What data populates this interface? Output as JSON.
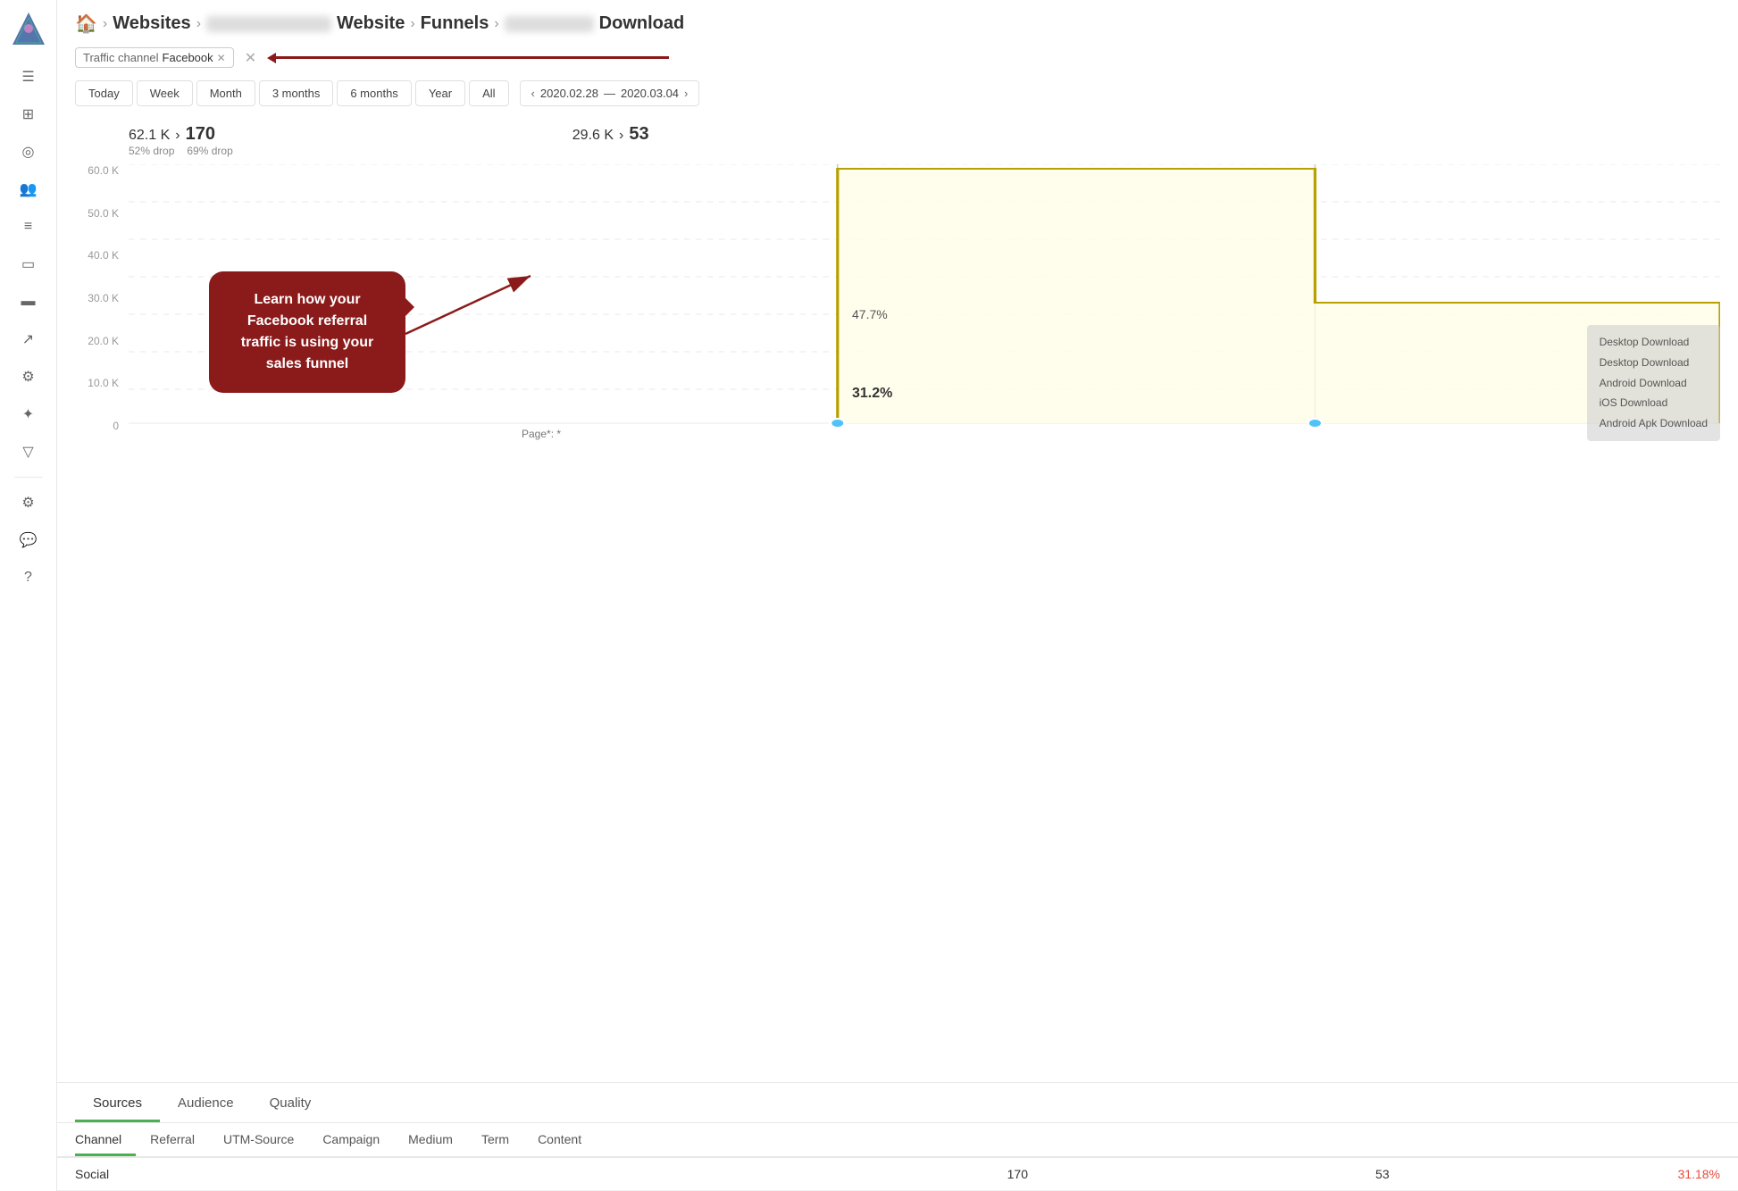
{
  "sidebar": {
    "icons": [
      "≡",
      "⊞",
      "◎",
      "👥",
      "⊟",
      "▭",
      "▬",
      "↗",
      "⚙",
      "✦",
      "▽",
      "⚙",
      "💬",
      "?"
    ]
  },
  "breadcrumb": {
    "home": "🏠",
    "websites": "Websites",
    "website": "Website",
    "funnels": "Funnels",
    "download": "Download"
  },
  "filter": {
    "channel_label": "Traffic channel",
    "channel_value": "Facebook",
    "add_filter": "+"
  },
  "time_range": {
    "buttons": [
      "Today",
      "Week",
      "Month",
      "3 months",
      "6 months",
      "Year",
      "All"
    ],
    "date_start": "2020.02.28",
    "date_end": "2020.03.04",
    "date_separator": "—"
  },
  "chart": {
    "stat1_label": "62.1 K",
    "stat1_arrow": "›",
    "stat1_value": "170",
    "stat1_drop1": "52% drop",
    "stat1_drop2": "69% drop",
    "stat2_label": "29.6 K",
    "stat2_arrow": "›",
    "stat2_value": "53",
    "y_axis": [
      "60.0 K",
      "50.0 K",
      "40.0 K",
      "30.0 K",
      "20.0 K",
      "10.0 K",
      "0"
    ],
    "pct1": "47.7%",
    "pct2": "31.2%",
    "page_label": "Page*: *",
    "callout_text": "Learn how your Facebook referral traffic is using your sales funnel",
    "download_items": [
      "Desktop Download",
      "Desktop Download",
      "Android Download",
      "iOS Download",
      "Android Apk Download"
    ]
  },
  "bottom_tabs": {
    "tabs": [
      "Sources",
      "Audience",
      "Quality"
    ],
    "active_tab": "Sources",
    "sub_tabs": [
      "Channel",
      "Referral",
      "UTM-Source",
      "Campaign",
      "Medium",
      "Term",
      "Content"
    ],
    "active_sub_tab": "Channel"
  },
  "table": {
    "row": {
      "channel": "Social",
      "value1": "170",
      "value2": "53",
      "pct": "31.18%"
    }
  }
}
